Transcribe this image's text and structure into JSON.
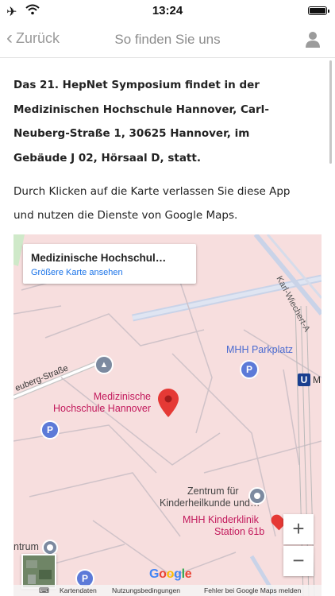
{
  "status_bar": {
    "time": "13:24"
  },
  "nav": {
    "back_label": "Zurück",
    "title": "So finden Sie uns"
  },
  "content": {
    "intro_lines": [
      "Das 21. HepNet Symposium findet in der",
      "Medizinischen Hochschule Hannover, Carl-",
      "Neuberg-Straße 1, 30625 Hannover, im",
      "Gebäude J 02, Hörsaal D, statt."
    ],
    "hint_lines": [
      "Durch Klicken auf die Karte verlassen Sie diese App",
      "und nutzen die Dienste von Google Maps."
    ]
  },
  "map": {
    "card_title": "Medizinische Hochschul…",
    "card_link": "Größere Karte ansehen",
    "labels": {
      "street_1": "Karl-Wiechert-A",
      "street_2": "euberg-Straße",
      "parkplatz": "MHH Parkplatz",
      "ubahn_m": "M",
      "pin_line1": "Medizinische",
      "pin_line2": "Hochschule Hannover",
      "zentrum_line1": "Zentrum für",
      "zentrum_line2": "Kinderheilkunde und…",
      "kinderklinik_line1": "MHH Kinderklinik",
      "kinderklinik_line2": "Station 61b",
      "left_partial": "ntrum",
      "parking_symbol": "P",
      "ubahn_symbol": "U",
      "zoom_in": "+",
      "zoom_out": "−",
      "google_g": "G",
      "google_o1": "o",
      "google_o2": "o",
      "google_g2": "g",
      "google_l": "l",
      "google_e": "e"
    },
    "footer": {
      "kartendaten": "Kartendaten",
      "nutzungsbedingungen": "Nutzungsbedingungen",
      "fehler": "Fehler bei Google Maps melden"
    },
    "colors": {
      "campus_fill": "#f7dede",
      "road": "#c8cfe0",
      "pin": "#e53935",
      "poi_text": "#c2185b",
      "link": "#1a73e8",
      "poi_blue": "#4a6ad0"
    }
  }
}
